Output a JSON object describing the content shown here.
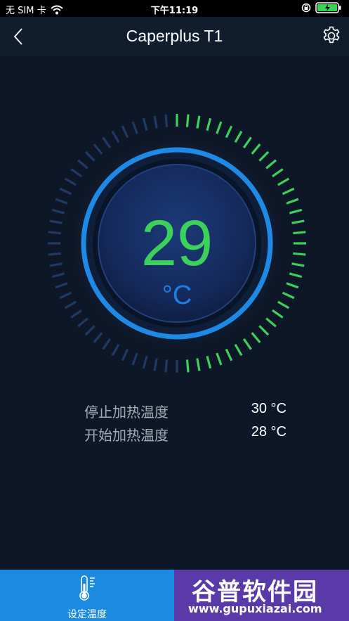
{
  "status_bar": {
    "carrier": "无 SIM 卡",
    "time": "下午11:19"
  },
  "nav": {
    "title": "Caperplus T1",
    "back_icon": "chevron-left-icon",
    "settings_icon": "gear-icon"
  },
  "dial": {
    "temperature": "29",
    "unit": "°C",
    "level_fraction": 0.5,
    "colors": {
      "value": "#3bd15a",
      "ring": "#1e7fe0",
      "ticks_active": "#3bd15a",
      "ticks_inactive": "#1f3a63"
    }
  },
  "info": {
    "stop_heat_label": "停止加热温度",
    "stop_heat_value": "30 °C",
    "start_heat_label": "开始加热温度",
    "start_heat_value": "28 °C"
  },
  "tab_bar": {
    "set_temp_label": "设定温度",
    "set_temp_icon": "thermometer-icon",
    "accent_color": "#1d8ae2"
  },
  "watermark": {
    "title": "谷普软件园",
    "url": "www.gupuxiazai.com"
  }
}
